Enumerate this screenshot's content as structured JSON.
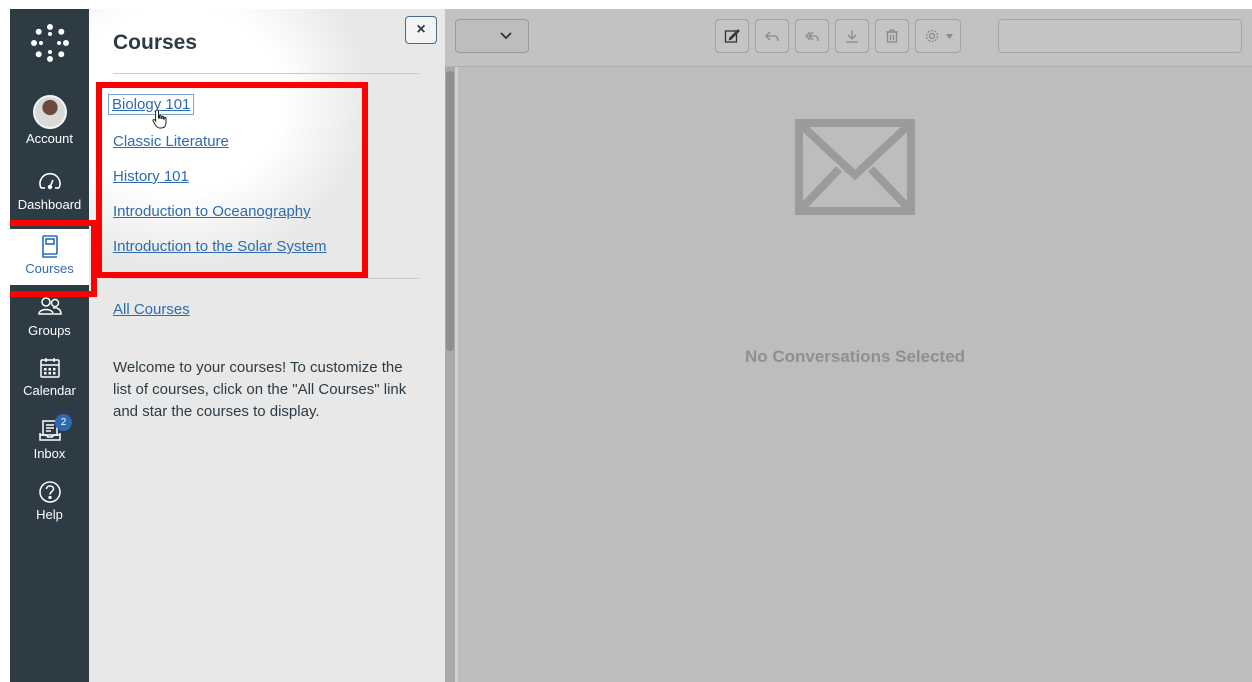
{
  "global_nav": {
    "items": [
      {
        "label": "Account",
        "icon": "avatar"
      },
      {
        "label": "Dashboard",
        "icon": "dashboard-icon"
      },
      {
        "label": "Courses",
        "icon": "courses-icon"
      },
      {
        "label": "Groups",
        "icon": "groups-icon"
      },
      {
        "label": "Calendar",
        "icon": "calendar-icon"
      },
      {
        "label": "Inbox",
        "icon": "inbox-icon",
        "badge": "2"
      },
      {
        "label": "Help",
        "icon": "help-icon"
      }
    ]
  },
  "tray": {
    "title": "Courses",
    "close_label": "×",
    "courses": [
      "Biology 101",
      "Classic Literature",
      "History 101",
      "Introduction to Oceanography",
      "Introduction to the Solar System"
    ],
    "all_courses": "All Courses",
    "welcome": "Welcome to your courses! To customize the list of courses, click on the \"All Courses\" link and star the courses to display."
  },
  "inbox": {
    "empty_message": "No Conversations Selected"
  },
  "colors": {
    "nav_bg": "#2d3b45",
    "link": "#2d6bb1",
    "highlight": "#ff0000"
  }
}
